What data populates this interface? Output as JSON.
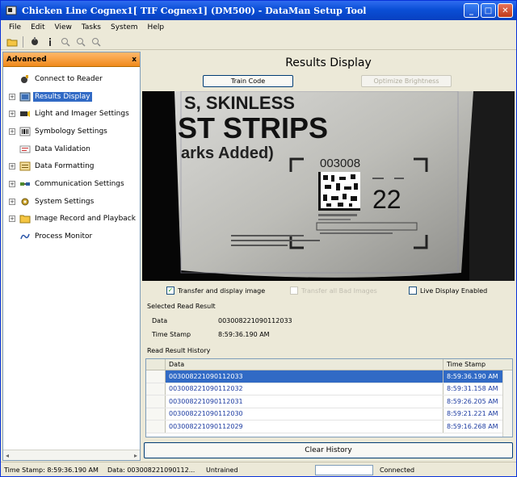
{
  "window": {
    "title": "Chicken Line Cognex1[ TIF Cognex1] (DM500) - DataMan Setup Tool"
  },
  "menu": [
    "File",
    "Edit",
    "View",
    "Tasks",
    "System",
    "Help"
  ],
  "left_panel": {
    "header": "Advanced",
    "close_glyph": "x",
    "items": [
      {
        "label": "Connect to Reader",
        "icon": "connect-icon",
        "expandable": false
      },
      {
        "label": "Results Display",
        "icon": "results-icon",
        "expandable": true,
        "selected": true
      },
      {
        "label": "Light and Imager Settings",
        "icon": "light-icon",
        "expandable": true
      },
      {
        "label": "Symbology Settings",
        "icon": "barcode-icon",
        "expandable": true
      },
      {
        "label": "Data Validation",
        "icon": "validation-icon",
        "expandable": false
      },
      {
        "label": "Data Formatting",
        "icon": "formatting-icon",
        "expandable": true
      },
      {
        "label": "Communication Settings",
        "icon": "communication-icon",
        "expandable": true
      },
      {
        "label": "System Settings",
        "icon": "system-icon",
        "expandable": true
      },
      {
        "label": "Image Record and Playback",
        "icon": "folder-icon",
        "expandable": true
      },
      {
        "label": "Process Monitor",
        "icon": "monitor-icon",
        "expandable": false
      }
    ]
  },
  "main": {
    "title": "Results Display",
    "train_code_label": "Train Code",
    "optimize_label": "Optimize Brightness",
    "image": {
      "line1": "S, SKINLESS",
      "line2": "ST STRIPS",
      "line3": "arks Added)",
      "code_number": "003008",
      "big_number": "22"
    },
    "checkbox_transfer": "Transfer and display image",
    "checkbox_transfer_checked": true,
    "checkbox_transfer_all": "Transfer all Bad Images",
    "checkbox_live": "Live Display Enabled",
    "checkbox_live_checked": false,
    "selected_read_result_label": "Selected Read Result",
    "data_label": "Data",
    "data_value": "003008221090112033",
    "time_stamp_label": "Time Stamp",
    "time_stamp_value": "8:59:36.190 AM",
    "history_label": "Read Result History",
    "history_columns": [
      "Data",
      "Time Stamp"
    ],
    "history_rows": [
      {
        "data": "003008221090112033",
        "time": "8:59:36.190 AM",
        "selected": true
      },
      {
        "data": "003008221090112032",
        "time": "8:59:31.158 AM"
      },
      {
        "data": "003008221090112031",
        "time": "8:59:26.205 AM"
      },
      {
        "data": "003008221090112030",
        "time": "8:59:21.221 AM"
      },
      {
        "data": "003008221090112029",
        "time": "8:59:16.268 AM"
      }
    ],
    "clear_history_label": "Clear History"
  },
  "status_bar": {
    "time_stamp": "Time Stamp: 8:59:36.190 AM",
    "data": "Data: 003008221090112...",
    "training": "Untrained",
    "connection": "Connected"
  },
  "colors": {
    "title_bar": "#0a4fd6",
    "panel_header": "#f08a1c",
    "selection": "#316ac5",
    "link_text": "#1b3aa0"
  }
}
